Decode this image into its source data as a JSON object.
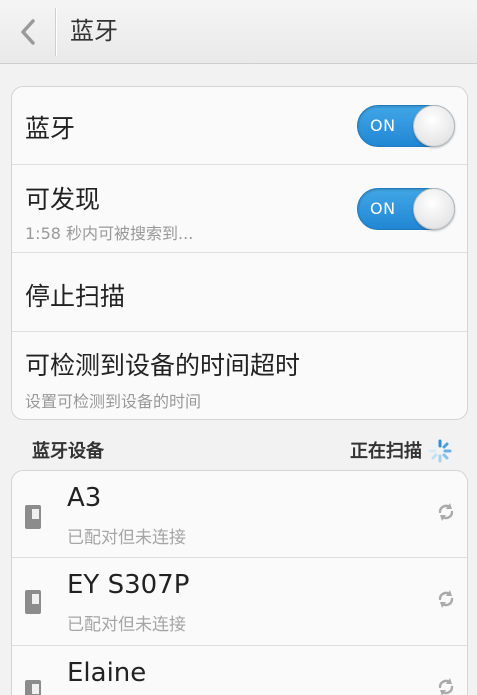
{
  "header": {
    "title": "蓝牙"
  },
  "settings": {
    "bluetooth": {
      "label": "蓝牙",
      "toggle_text": "ON"
    },
    "discoverable": {
      "label": "可发现",
      "sub": "1:58 秒内可被搜索到...",
      "toggle_text": "ON"
    },
    "stop_scan": {
      "label": "停止扫描"
    },
    "timeout": {
      "label": "可检测到设备的时间超时",
      "sub": "设置可检测到设备的时间"
    }
  },
  "devices_section": {
    "title": "蓝牙设备",
    "status": "正在扫描"
  },
  "devices": [
    {
      "name": "A3",
      "status": "已配对但未连接"
    },
    {
      "name": "EY S307P",
      "status": "已配对但未连接"
    },
    {
      "name": "Elaine",
      "status": ""
    }
  ],
  "colors": {
    "toggle_on": "#2a90d9",
    "background": "#f2f2f2"
  },
  "icons": {
    "back": "chevron-left-icon",
    "device": "phone-icon",
    "refresh": "refresh-icon",
    "scanning": "spinner-icon"
  }
}
